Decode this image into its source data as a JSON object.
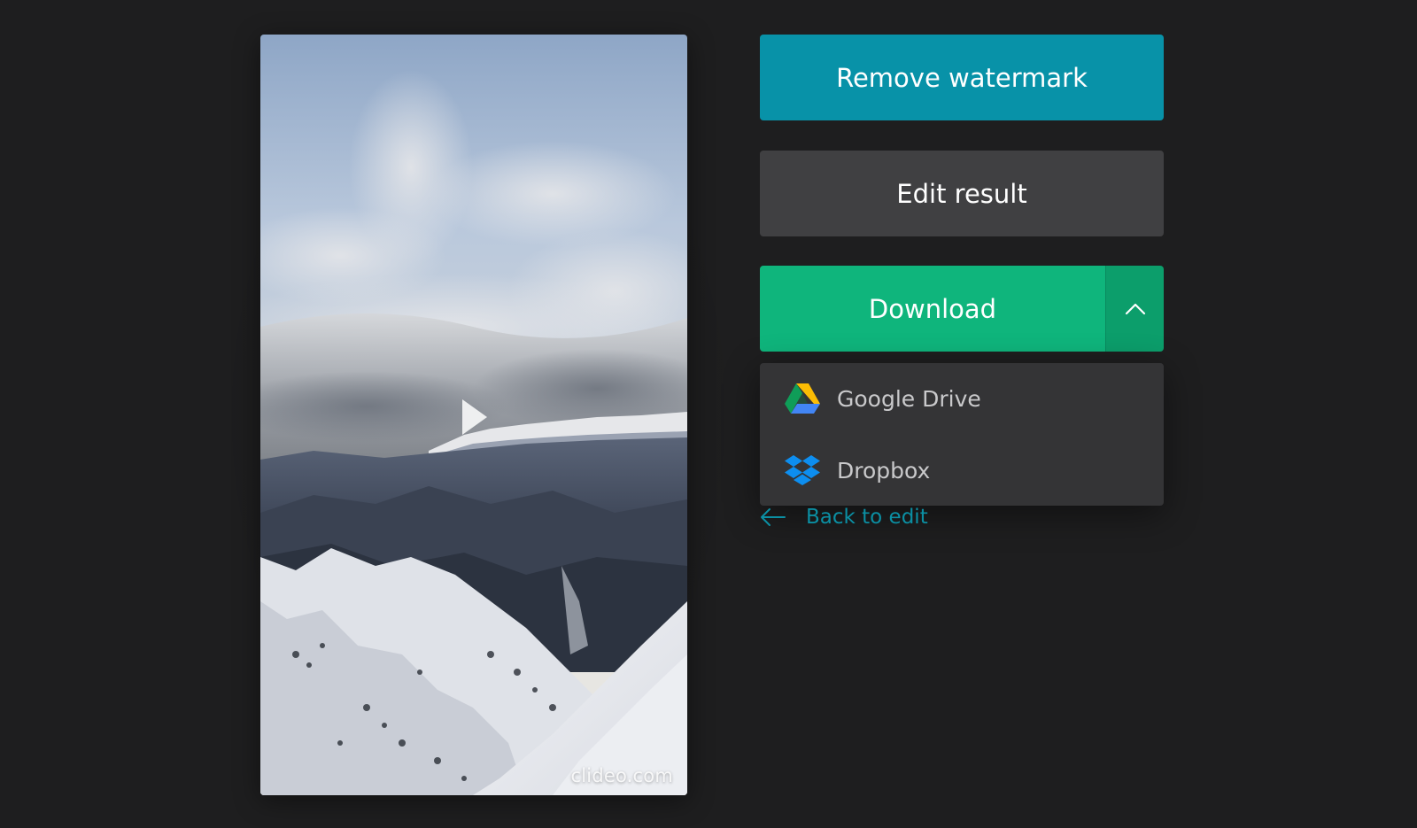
{
  "preview": {
    "watermark": "clideo.com",
    "play_icon": "play-icon"
  },
  "actions": {
    "remove_watermark_label": "Remove watermark",
    "edit_result_label": "Edit result",
    "download_label": "Download",
    "download_toggle_icon": "chevron-up-icon"
  },
  "download_menu": {
    "items": [
      {
        "label": "Google Drive",
        "icon": "google-drive-icon"
      },
      {
        "label": "Dropbox",
        "icon": "dropbox-icon"
      }
    ]
  },
  "back_link": {
    "label": "Back to edit",
    "icon": "arrow-left-icon"
  },
  "colors": {
    "background": "#1e1e1f",
    "remove_watermark": "#0892a8",
    "edit_result": "#404042",
    "download": "#0fb57c",
    "download_toggle": "#0c9e6b",
    "menu": "#343436",
    "link": "#0b8fa3"
  }
}
